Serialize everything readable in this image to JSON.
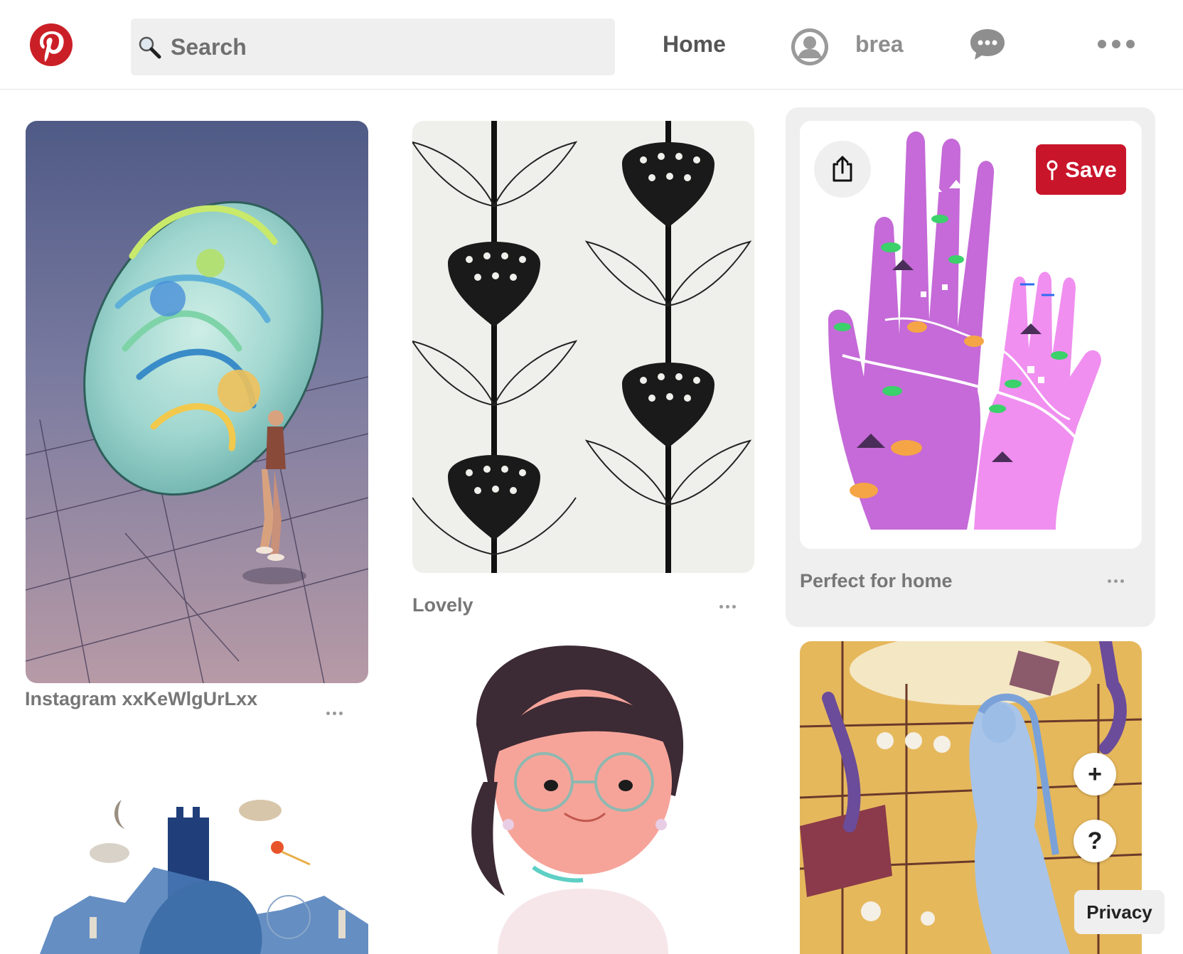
{
  "header": {
    "logo": "pinterest-logo",
    "search_placeholder": "Search",
    "nav_home": "Home",
    "username": "brea",
    "messages_icon": "speech-bubble-icon",
    "more_icon": "ellipsis-icon"
  },
  "pins": [
    {
      "title": "Instagram xxKeWlgUrLxx",
      "image": "bubble-city-illustration"
    },
    {
      "title": "Lovely",
      "image": "black-white-leaf-pattern"
    },
    {
      "title": "Perfect for home",
      "image": "hands-landscape-illustration"
    },
    {
      "title": "",
      "image": "blue-city-watercolor"
    },
    {
      "title": "",
      "image": "girl-with-glasses-illustration"
    },
    {
      "title": "",
      "image": "blue-woman-machine-comic"
    }
  ],
  "hover_actions": {
    "save_label": "Save",
    "share_icon": "share-icon",
    "pin_icon": "pin-icon"
  },
  "floating": {
    "add_label": "+",
    "help_label": "?",
    "privacy_label": "Privacy"
  },
  "colors": {
    "brand_red": "#cb1f27",
    "save_red": "#c8152a",
    "hover_gray": "#efefef"
  }
}
